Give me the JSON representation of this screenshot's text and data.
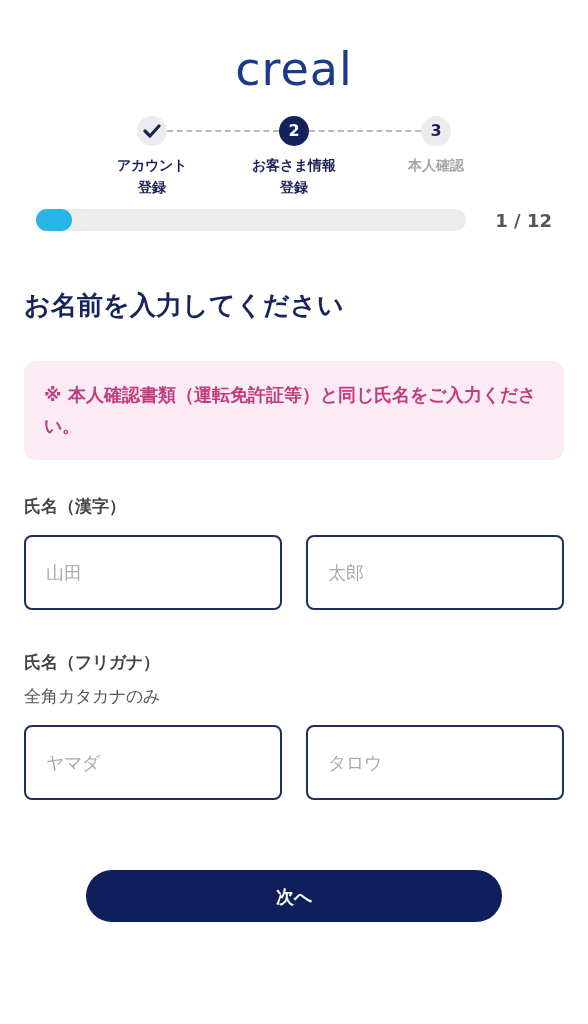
{
  "logo": "creal",
  "steps": [
    {
      "label_lines": [
        "アカウント",
        "登録"
      ],
      "done": true,
      "selected": false
    },
    {
      "number": "2",
      "label_lines": [
        "お客さま情報",
        "登録"
      ],
      "done": false,
      "selected": true
    },
    {
      "number": "3",
      "label_lines": [
        "本人確認"
      ],
      "done": false,
      "selected": false
    }
  ],
  "progress": {
    "level": 0.083,
    "reading": "1 / 12"
  },
  "heading": "お名前を入力してください",
  "notice": "※ 本人確認書類（運転免許証等）と同じ氏名をご入力ください。",
  "field_groups": [
    {
      "label": "氏名（漢字）",
      "fields": [
        {
          "placeholder": "山田"
        },
        {
          "placeholder": "太郎"
        }
      ]
    },
    {
      "label": "氏名（フリガナ）",
      "hint": "全角カタカナのみ",
      "fields": [
        {
          "placeholder": "ヤマダ"
        },
        {
          "placeholder": "タロウ"
        }
      ]
    }
  ],
  "next_button": "次へ"
}
